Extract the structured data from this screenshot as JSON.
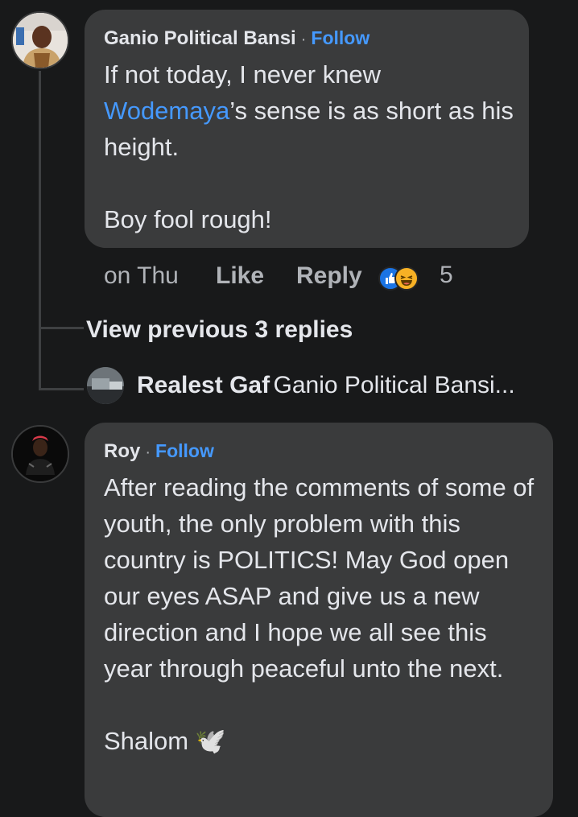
{
  "comment1": {
    "author": "Ganio Political Bansi",
    "separator": "·",
    "follow_label": "Follow",
    "text_before_mention": "If not today, I never knew ",
    "mention": "Wodemaya",
    "text_after_mention": "’s sense is as short as his height.\n\nBoy fool rough!",
    "timestamp": "on Thu",
    "like_label": "Like",
    "reply_label": "Reply",
    "reaction_count": "5",
    "reaction_icons": [
      "like-icon",
      "haha-icon"
    ]
  },
  "replies": {
    "view_previous_label": "View previous 3 replies",
    "last_reply": {
      "author": "Realest Gaf",
      "snippet": "Ganio Political Bansi..."
    }
  },
  "comment2": {
    "author": "Roy",
    "separator": "·",
    "follow_label": "Follow",
    "text": "After reading the comments of some of youth, the only problem with this country is POLITICS! May God open our eyes ASAP and give us a new direction and I hope we all see this year through peaceful unto the next.\n\nShalom",
    "dove_emoji": "🕊️"
  },
  "colors": {
    "background": "#18191a",
    "bubble": "#3a3b3c",
    "link": "#4599ff",
    "secondary_text": "#b0b3b8"
  }
}
